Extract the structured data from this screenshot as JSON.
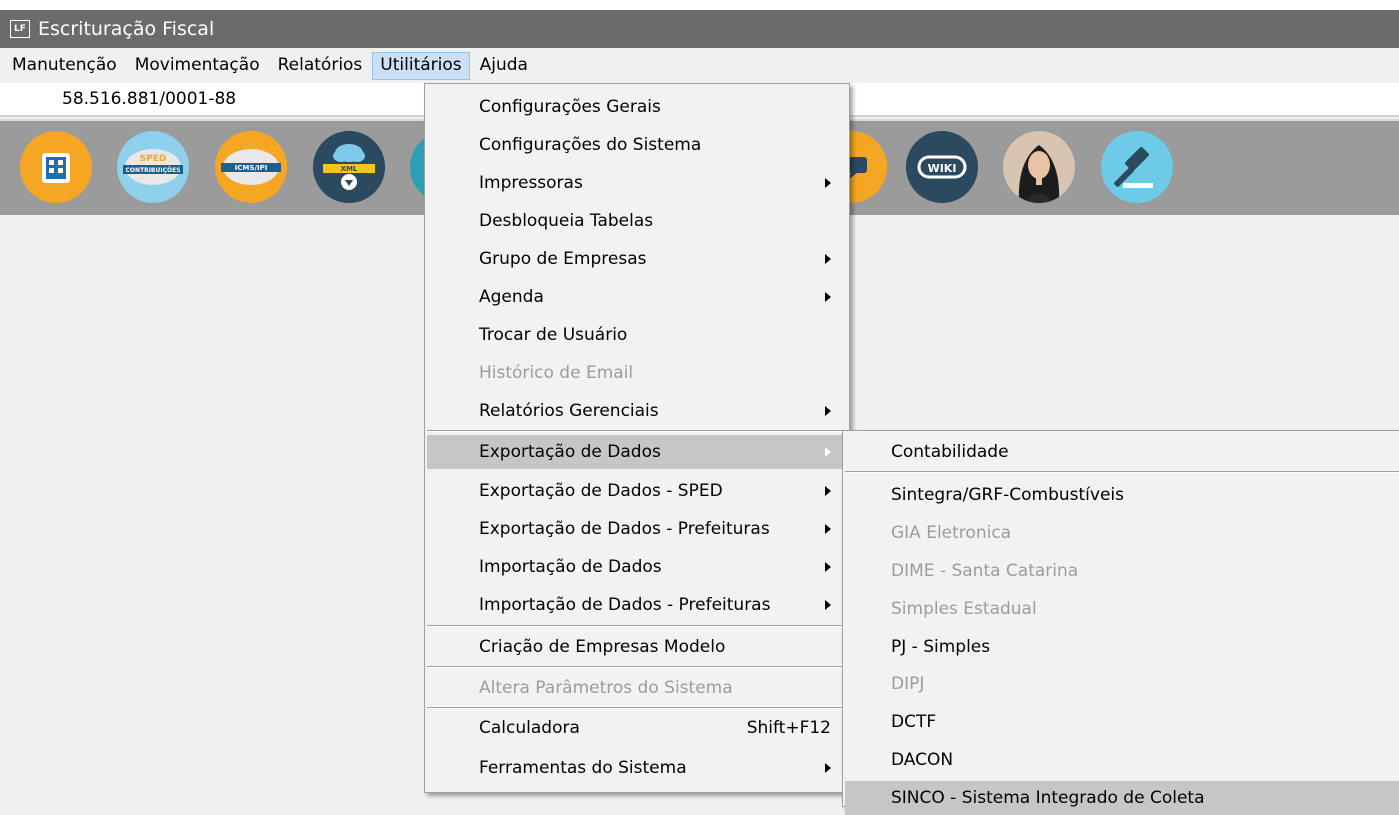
{
  "window": {
    "app_icon": "LF",
    "title": "Escrituração Fiscal"
  },
  "menubar": {
    "items": [
      {
        "label": "Manutenção"
      },
      {
        "label": "Movimentação"
      },
      {
        "label": "Relatórios"
      },
      {
        "label": "Utilitários"
      },
      {
        "label": "Ajuda"
      }
    ],
    "active": "Utilitários"
  },
  "company": {
    "cnpj": "58.516.881/0001-88"
  },
  "toolbar": {
    "icons": [
      {
        "name": "building-icon"
      },
      {
        "name": "sped-contribuicoes-icon",
        "text_top": "SPED",
        "text_bottom": "CONTRIBUIÇÕES"
      },
      {
        "name": "sped-icms-ipi-icon",
        "text": "ICMS/IPI"
      },
      {
        "name": "xml-download-icon",
        "text": "XML"
      },
      {
        "name": "chat-icon"
      },
      {
        "name": "wiki-icon",
        "text": "WIKI"
      },
      {
        "name": "assistant-avatar-icon"
      },
      {
        "name": "legal-gavel-icon"
      }
    ]
  },
  "utilities_menu": {
    "items": [
      {
        "label": "Configurações Gerais",
        "submenu": false,
        "disabled": false
      },
      {
        "label": "Configurações do Sistema",
        "submenu": false,
        "disabled": false
      },
      {
        "label": "Impressoras",
        "submenu": true,
        "disabled": false
      },
      {
        "label": "Desbloqueia Tabelas",
        "submenu": false,
        "disabled": false
      },
      {
        "label": "Grupo de Empresas",
        "submenu": true,
        "disabled": false
      },
      {
        "label": "Agenda",
        "submenu": true,
        "disabled": false
      },
      {
        "label": "Trocar de Usuário",
        "submenu": false,
        "disabled": false
      },
      {
        "label": "Histórico de Email",
        "submenu": false,
        "disabled": true
      },
      {
        "label": "Relatórios Gerenciais",
        "submenu": true,
        "disabled": false
      },
      {
        "label": "Exportação de Dados",
        "submenu": true,
        "disabled": false,
        "highlighted": true
      },
      {
        "label": "Exportação de Dados - SPED",
        "submenu": true,
        "disabled": false
      },
      {
        "label": "Exportação de Dados - Prefeituras",
        "submenu": true,
        "disabled": false
      },
      {
        "label": "Importação de Dados",
        "submenu": true,
        "disabled": false
      },
      {
        "label": "Importação de Dados - Prefeituras",
        "submenu": true,
        "disabled": false
      },
      {
        "label": "Criação de Empresas Modelo",
        "submenu": false,
        "disabled": false
      },
      {
        "label": "Altera Parâmetros do Sistema",
        "submenu": false,
        "disabled": true
      },
      {
        "label": "Calculadora",
        "submenu": false,
        "disabled": false,
        "shortcut": "Shift+F12"
      },
      {
        "label": "Ferramentas do Sistema",
        "submenu": true,
        "disabled": false
      }
    ]
  },
  "export_submenu": {
    "items": [
      {
        "label": "Contabilidade",
        "disabled": false
      },
      {
        "label": "Sintegra/GRF-Combustíveis",
        "disabled": false
      },
      {
        "label": "GIA Eletronica",
        "disabled": true
      },
      {
        "label": "DIME - Santa Catarina",
        "disabled": true
      },
      {
        "label": "Simples Estadual",
        "disabled": true
      },
      {
        "label": "PJ - Simples",
        "disabled": false
      },
      {
        "label": "DIPJ",
        "disabled": true
      },
      {
        "label": "DCTF",
        "disabled": false
      },
      {
        "label": "DACON",
        "disabled": false
      },
      {
        "label": "SINCO - Sistema Integrado de Coleta",
        "disabled": false,
        "highlighted": true
      }
    ]
  },
  "colors": {
    "titlebar": "#6b6b6b",
    "toolbar": "#9b9b9b",
    "menu_bg": "#f2f2f2",
    "highlight": "#c6c6c6",
    "disabled_text": "#9c9c9c",
    "active_menu": "#cce0f5"
  }
}
